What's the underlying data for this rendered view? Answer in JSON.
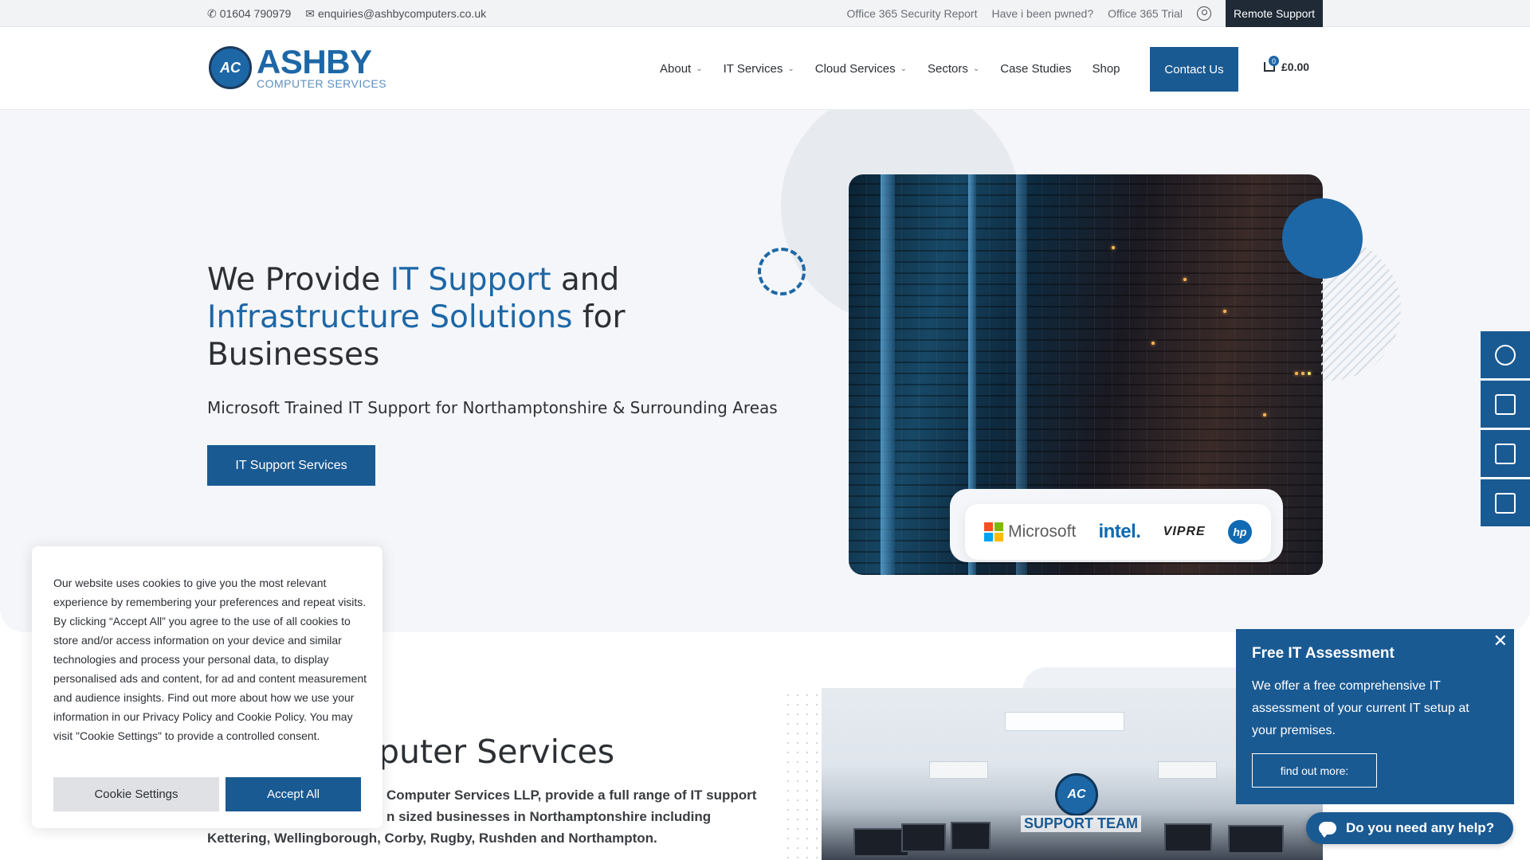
{
  "topbar": {
    "phone": "01604 790979",
    "email": "enquiries@ashbycomputers.co.uk",
    "links": [
      "Office 365 Security Report",
      "Have i been pwned?",
      "Office 365 Trial"
    ],
    "remote_support": "Remote Support"
  },
  "header": {
    "logo_main": "ASHBY",
    "logo_sub": "COMPUTER SERVICES",
    "nav": [
      {
        "label": "About",
        "dropdown": true
      },
      {
        "label": "IT Services",
        "dropdown": true
      },
      {
        "label": "Cloud Services",
        "dropdown": true
      },
      {
        "label": "Sectors",
        "dropdown": true
      },
      {
        "label": "Case Studies",
        "dropdown": false
      },
      {
        "label": "Shop",
        "dropdown": false
      }
    ],
    "contact_label": "Contact Us",
    "cart_count": "0",
    "cart_total": "£0.00"
  },
  "hero": {
    "title_1": "We Provide ",
    "title_hl_1": "IT Support",
    "title_2": " and",
    "title_hl_2": "Infrastructure Solutions",
    "title_3": " for",
    "title_4": "Businesses",
    "subtitle": "Microsoft Trained IT Support for Northamptonshire & Surrounding Areas",
    "cta_label": "IT Support Services",
    "partners": [
      "Microsoft",
      "intel.",
      "VIPRE",
      "hp"
    ]
  },
  "section2": {
    "title": "puter Services",
    "text_line1": " Computer Services LLP, provide a full range of IT support",
    "text_line2": "n sized businesses in Northamptonshire including",
    "text_line3": "Kettering, Wellingborough, Corby, Rugby, Rushden and Northampton.",
    "support_team": "SUPPORT TEAM"
  },
  "cookie": {
    "text": "Our website uses cookies to give you the most relevant experience by remembering your preferences and repeat visits. By clicking “Accept All” you agree to the use of all cookies to store and/or access information on your device and similar technologies and process your personal data, to display personalised ads and content, for ad and content measurement and audience insights. Find out more about how we use your information in our Privacy Policy and Cookie Policy. You may visit \"Cookie Settings\" to provide a controlled consent.",
    "settings_label": "Cookie Settings",
    "accept_label": "Accept All"
  },
  "assessment": {
    "title": "Free IT Assessment",
    "text": "We offer a free comprehensive IT assessment of your current IT setup at your premises.",
    "button": "find out more:",
    "close": "✕"
  },
  "help": {
    "label": "Do you need any help?"
  },
  "colors": {
    "brand_blue": "#1d67a6",
    "dark_blue": "#1a5a93"
  }
}
